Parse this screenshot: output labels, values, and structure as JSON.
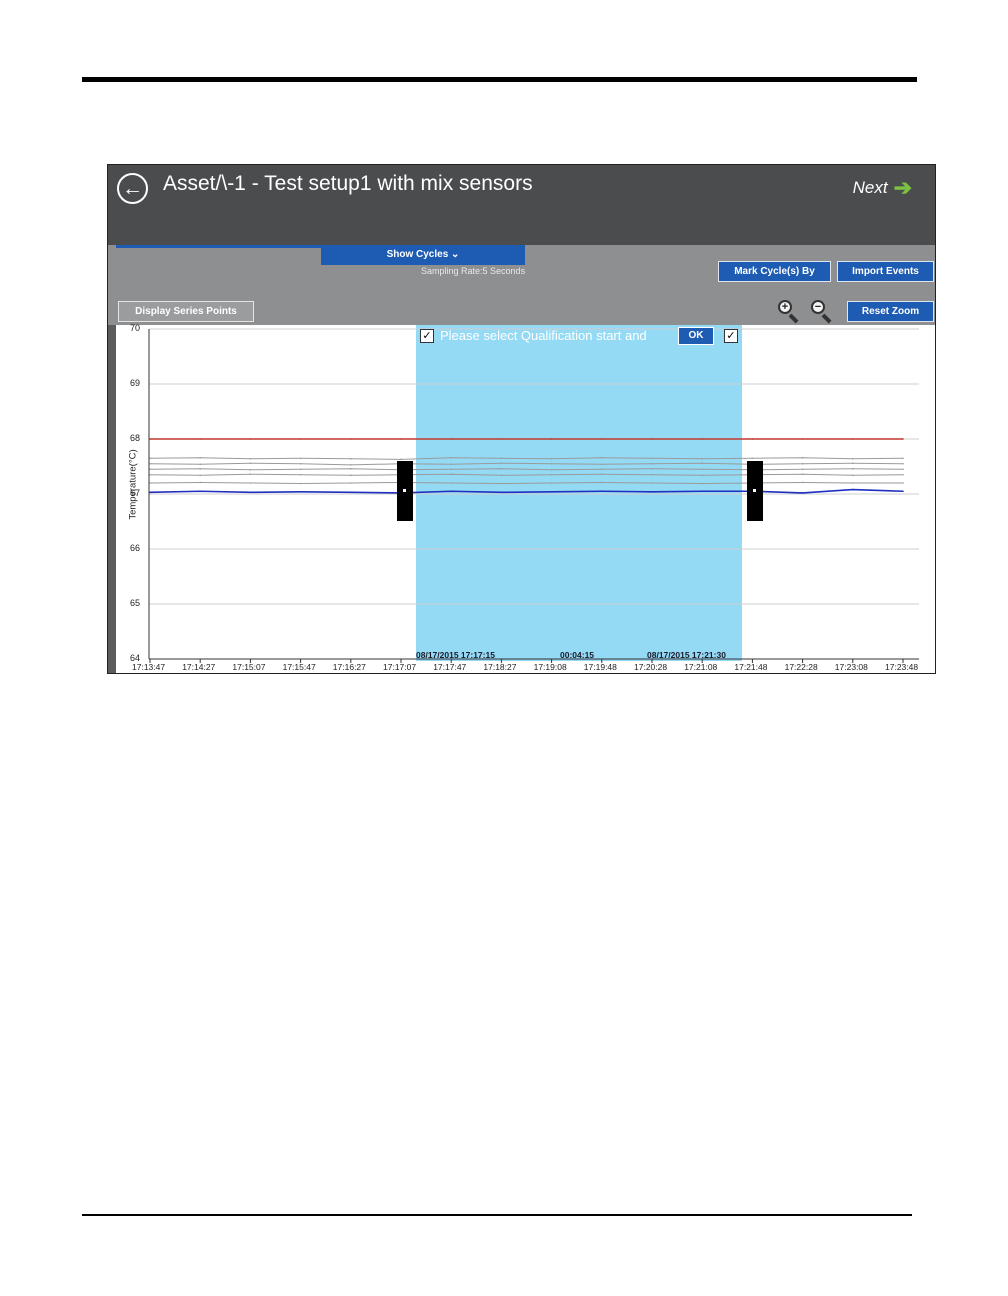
{
  "window": {
    "title": "Asset/\\-1 - Test setup1 with mix sensors",
    "back_icon": "arrow-left-circle-icon",
    "next_label": "Next",
    "next_icon": "arrow-right-icon"
  },
  "toolbar": {
    "show_cycles": "Show Cycles",
    "sampling_rate": "Sampling Rate:5 Seconds",
    "mark_cycles": "Mark Cycle(s) By",
    "import_events": "Import Events",
    "display_series_points": "Display Series Points",
    "reset_zoom": "Reset Zoom",
    "zoom_in_icon": "zoom-in-icon",
    "zoom_out_icon": "zoom-out-icon"
  },
  "qualification": {
    "prompt": "Please select Qualification start and",
    "ok_label": "OK",
    "start_label": "08/17/2015 17:17:15",
    "duration_label": "00:04:15",
    "end_label": "08/17/2015 17:21:30",
    "highlight_color": "#8fd8f4"
  },
  "chart_data": {
    "type": "line",
    "ylabel": "Temperature(°C)",
    "xlabel": "",
    "ylim": [
      64,
      70
    ],
    "yticks": [
      "70",
      "69",
      "68",
      "67",
      "66",
      "65",
      "64"
    ],
    "x": [
      "17:13:47",
      "17:14:27",
      "17:15:07",
      "17:15:47",
      "17:16:27",
      "17:17:07",
      "17:17:47",
      "17:18:27",
      "17:19:08",
      "17:19:48",
      "17:20:28",
      "17:21:08",
      "17:21:48",
      "17:22:28",
      "17:23:08",
      "17:23:48"
    ],
    "grid": true,
    "selection": {
      "start": "17:17:15",
      "end": "17:21:30"
    },
    "series": [
      {
        "color": "#c0392b",
        "values": [
          68.0,
          68.0,
          68.0,
          68.0,
          68.0,
          68.0,
          68.0,
          68.0,
          68.0,
          68.0,
          68.0,
          68.0,
          68.0,
          68.0,
          68.0,
          68.0
        ]
      },
      {
        "color": "#1f2fbf",
        "values": [
          67.03,
          67.05,
          67.03,
          67.04,
          67.03,
          67.02,
          67.05,
          67.03,
          67.04,
          67.05,
          67.04,
          67.05,
          67.05,
          67.02,
          67.08,
          67.05
        ]
      },
      {
        "color": "#9a9a9a",
        "values": [
          67.65,
          67.66,
          67.64,
          67.65,
          67.64,
          67.63,
          67.66,
          67.65,
          67.64,
          67.66,
          67.65,
          67.64,
          67.65,
          67.66,
          67.64,
          67.65
        ]
      },
      {
        "color": "#9a9a9a",
        "values": [
          67.55,
          67.54,
          67.56,
          67.55,
          67.53,
          67.55,
          67.54,
          67.56,
          67.55,
          67.54,
          67.55,
          67.56,
          67.54,
          67.55,
          67.56,
          67.55
        ]
      },
      {
        "color": "#9a9a9a",
        "values": [
          67.45,
          67.46,
          67.44,
          67.45,
          67.46,
          67.44,
          67.45,
          67.46,
          67.44,
          67.45,
          67.46,
          67.45,
          67.44,
          67.45,
          67.46,
          67.45
        ]
      },
      {
        "color": "#9a9a9a",
        "values": [
          67.35,
          67.34,
          67.36,
          67.35,
          67.34,
          67.35,
          67.36,
          67.34,
          67.35,
          67.36,
          67.35,
          67.34,
          67.35,
          67.36,
          67.34,
          67.35
        ]
      },
      {
        "color": "#9a9a9a",
        "values": [
          67.2,
          67.21,
          67.2,
          67.19,
          67.2,
          67.21,
          67.2,
          67.19,
          67.2,
          67.21,
          67.2,
          67.19,
          67.2,
          67.21,
          67.2,
          67.2
        ]
      }
    ]
  }
}
